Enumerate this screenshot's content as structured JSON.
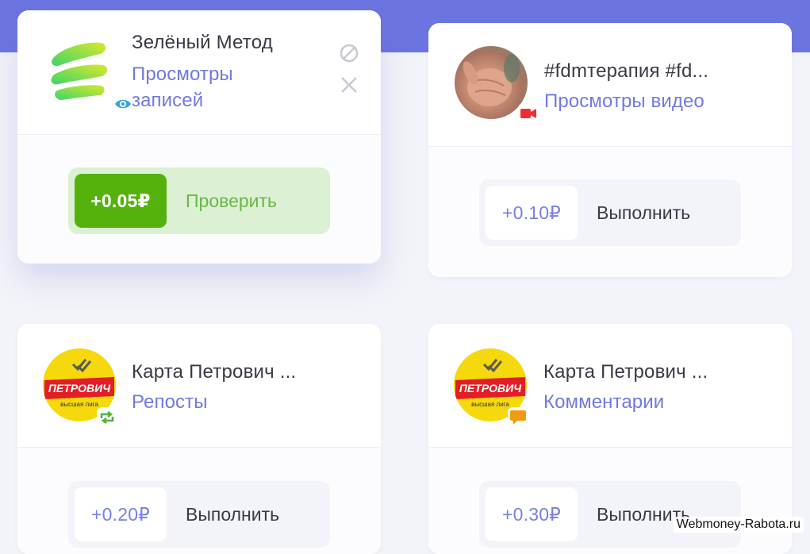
{
  "cards": [
    {
      "title": "Зелёный Метод",
      "subtitle": "Просмотры записей",
      "badge_icon": "eye-icon",
      "reward": "+0.05₽",
      "action": "Проверить"
    },
    {
      "title": "#fdmтерапия #fd...",
      "subtitle": "Просмотры видео",
      "badge_icon": "video-camera-icon",
      "reward": "+0.10₽",
      "action": "Выполнить"
    },
    {
      "title": "Карта Петрович ...",
      "subtitle": "Репосты",
      "badge_icon": "repost-icon",
      "avatar_logo_text": "ПЕТРОВИЧ",
      "avatar_logo_sub": "высшая лига",
      "reward": "+0.20₽",
      "action": "Выполнить"
    },
    {
      "title": "Карта Петрович ...",
      "subtitle": "Комментарии",
      "badge_icon": "comment-icon",
      "avatar_logo_text": "ПЕТРОВИЧ",
      "avatar_logo_sub": "высшая лига",
      "reward": "+0.30₽",
      "action": "Выполнить"
    }
  ],
  "colors": {
    "accent": "#6f79e3",
    "header_band": "#6c74e0",
    "success": "#55b20d",
    "success_bg": "#dcf1d3"
  },
  "watermark": "Webmoney-Rabota.ru"
}
